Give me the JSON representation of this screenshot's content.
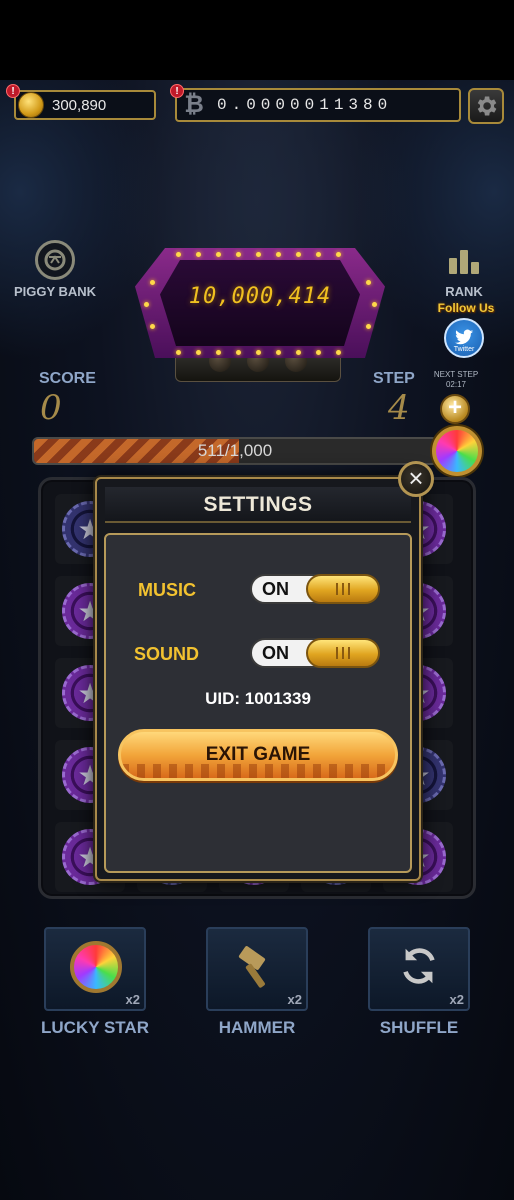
{
  "top_bar": {
    "coins": "300,890",
    "coins_alert": "!",
    "btc_value": "0.0000011380",
    "btc_alert": "!",
    "btc_symbol": "₿",
    "settings_icon": "gear-icon"
  },
  "side": {
    "piggy_bank_label": "PIGGY BANK",
    "rank_label": "RANK",
    "follow_us": "Follow Us",
    "twitter_label": "Twitter"
  },
  "jackpot": {
    "value": "10,000,414"
  },
  "stats": {
    "score_label": "SCORE",
    "score_value": "0",
    "step_label": "STEP",
    "step_value": "4",
    "next_step_label": "NEXT STEP",
    "next_step_time": "02:17"
  },
  "progress": {
    "text": "511/1,000",
    "current": 511,
    "max": 1000
  },
  "board": {
    "rows": [
      [
        "blue",
        "purple",
        "purple",
        "blue",
        "purple"
      ],
      [
        "purple",
        "blue",
        "purple",
        "purple",
        "purple"
      ],
      [
        "purple",
        "purple",
        "blue",
        "purple",
        "purple"
      ],
      [
        "purple",
        "blue",
        "purple",
        "blue",
        "blue"
      ],
      [
        "purple",
        "blue",
        "purple",
        "blue",
        "purple"
      ]
    ]
  },
  "settings": {
    "title": "SETTINGS",
    "music_label": "MUSIC",
    "music_state": "ON",
    "sound_label": "SOUND",
    "sound_state": "ON",
    "uid": "UID: 1001339",
    "exit_label": "EXIT GAME",
    "close_glyph": "×"
  },
  "boosters": [
    {
      "label": "LUCKY STAR",
      "count": "x2",
      "icon": "rainbow-ball-icon"
    },
    {
      "label": "HAMMER",
      "count": "x2",
      "icon": "hammer-icon"
    },
    {
      "label": "SHUFFLE",
      "count": "x2",
      "icon": "shuffle-icon"
    }
  ],
  "colors": {
    "gold_accent": "#f2c230",
    "frame_gold": "#a88a3a",
    "label_blue": "#8fa6c8",
    "chip_purple": "#6a2a9a",
    "chip_blue": "#33336f"
  }
}
